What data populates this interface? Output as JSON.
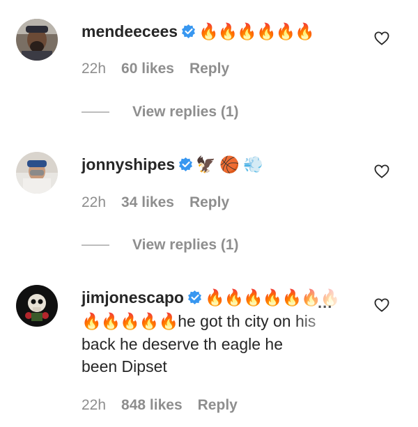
{
  "comments": [
    {
      "username": "mendeecees",
      "emoji": "🔥🔥🔥🔥🔥🔥",
      "text": "",
      "time": "22h",
      "likes": "60 likes",
      "reply": "Reply",
      "view_replies": "View replies (1)"
    },
    {
      "username": "jonnyshipes",
      "emoji": "🦅 🏀 💨",
      "text": "",
      "time": "22h",
      "likes": "34 likes",
      "reply": "Reply",
      "view_replies": "View replies (1)"
    },
    {
      "username": "jimjonescapo",
      "emoji": "🔥🔥🔥🔥🔥🔥🔥",
      "emoji2": "🔥🔥🔥🔥🔥",
      "text_line1": "he got th city on his",
      "text_line2": "back he deserve th eagle he",
      "text_line3": "been Dipset",
      "more": "...",
      "time": "22h",
      "likes": "848 likes",
      "reply": "Reply"
    }
  ],
  "colors": {
    "verified": "#3897f0",
    "text": "#262626",
    "muted": "#8e8e8e"
  },
  "icons": {
    "like": "heart-outline-icon",
    "verified": "verified-badge-icon"
  }
}
